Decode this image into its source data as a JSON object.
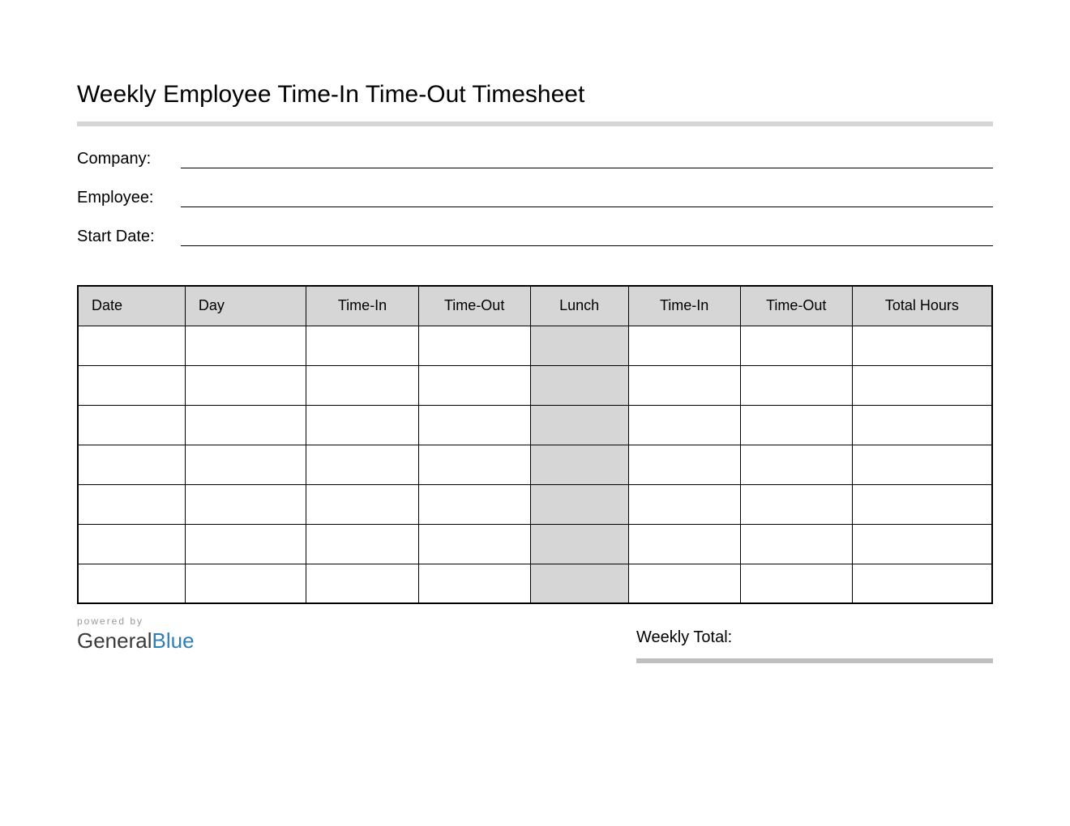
{
  "title": "Weekly Employee Time-In Time-Out Timesheet",
  "info": {
    "company_label": "Company:",
    "company_value": "",
    "employee_label": "Employee:",
    "employee_value": "",
    "startdate_label": "Start Date:",
    "startdate_value": ""
  },
  "table": {
    "headers": {
      "date": "Date",
      "day": "Day",
      "time_in_1": "Time-In",
      "time_out_1": "Time-Out",
      "lunch": "Lunch",
      "time_in_2": "Time-In",
      "time_out_2": "Time-Out",
      "total_hours": "Total Hours"
    },
    "rows": [
      {
        "date": "",
        "day": "",
        "time_in_1": "",
        "time_out_1": "",
        "lunch": "",
        "time_in_2": "",
        "time_out_2": "",
        "total_hours": ""
      },
      {
        "date": "",
        "day": "",
        "time_in_1": "",
        "time_out_1": "",
        "lunch": "",
        "time_in_2": "",
        "time_out_2": "",
        "total_hours": ""
      },
      {
        "date": "",
        "day": "",
        "time_in_1": "",
        "time_out_1": "",
        "lunch": "",
        "time_in_2": "",
        "time_out_2": "",
        "total_hours": ""
      },
      {
        "date": "",
        "day": "",
        "time_in_1": "",
        "time_out_1": "",
        "lunch": "",
        "time_in_2": "",
        "time_out_2": "",
        "total_hours": ""
      },
      {
        "date": "",
        "day": "",
        "time_in_1": "",
        "time_out_1": "",
        "lunch": "",
        "time_in_2": "",
        "time_out_2": "",
        "total_hours": ""
      },
      {
        "date": "",
        "day": "",
        "time_in_1": "",
        "time_out_1": "",
        "lunch": "",
        "time_in_2": "",
        "time_out_2": "",
        "total_hours": ""
      },
      {
        "date": "",
        "day": "",
        "time_in_1": "",
        "time_out_1": "",
        "lunch": "",
        "time_in_2": "",
        "time_out_2": "",
        "total_hours": ""
      }
    ]
  },
  "footer": {
    "powered_by": "powered by",
    "logo_general": "General",
    "logo_blue": "Blue",
    "weekly_total_label": "Weekly Total:",
    "weekly_total_value": ""
  }
}
